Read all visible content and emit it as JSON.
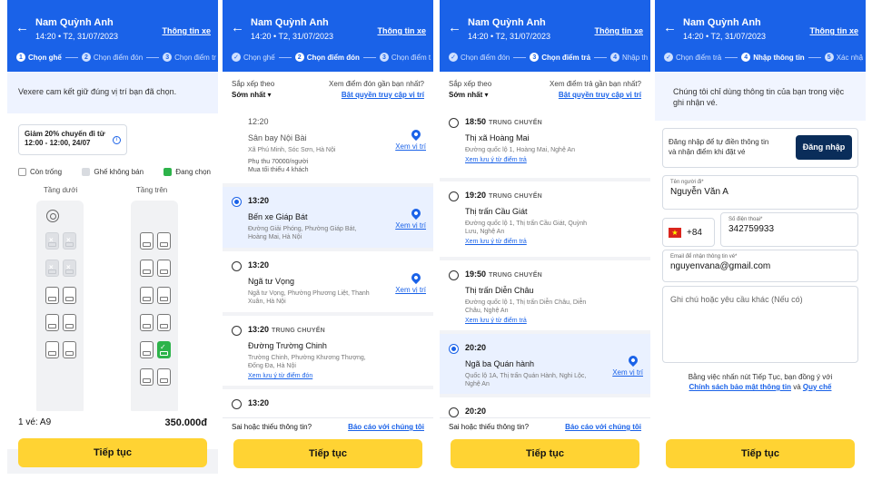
{
  "header": {
    "passenger": "Nam Quỳnh Anh",
    "trip_time": "14:20 • T2, 31/07/2023",
    "bus_info": "Thông tin xe"
  },
  "panel1": {
    "steps": [
      {
        "n": "1",
        "label": "Chọn ghế"
      },
      {
        "n": "2",
        "label": "Chọn điểm đón"
      },
      {
        "n": "3",
        "label": "Chọn điểm tr"
      }
    ],
    "commit_text": "Vexere cam kết giữ đúng vị trí bạn đã chọn.",
    "coupon_line1": "Giảm 20% chuyến đi từ",
    "coupon_line2": "12:00 - 12:00, 24/07",
    "legend": {
      "empty": "Còn trống",
      "sold": "Ghế không bán",
      "selected": "Đang chọn"
    },
    "deck_lower": "Tầng dưới",
    "deck_upper": "Tầng trên",
    "seat_icon": "seat-icon",
    "summary_label": "1 vé: A9",
    "total": "350.000đ",
    "cta": "Tiếp tục"
  },
  "panel2": {
    "steps": [
      {
        "n": "✓",
        "label": "Chọn ghế"
      },
      {
        "n": "2",
        "label": "Chọn điểm đón"
      },
      {
        "n": "3",
        "label": "Chọn điểm t"
      }
    ],
    "sort_label": "Sắp xếp theo",
    "sort_value": "Sớm nhất ▾",
    "nearest_label": "Xem điểm đón gần bạn nhất?",
    "nearest_link": "Bật quyền truy cập vị trí",
    "items": [
      {
        "time": "12:20",
        "tag": "",
        "name": "Sân bay Nội Bài",
        "addr": "Xã Phú Minh, Sóc Sơn, Hà Nội",
        "extra1": "Phụ thu 70000/người",
        "extra2": "Mua tối thiểu 4 khách",
        "link": "",
        "map": "Xem vị trí"
      },
      {
        "time": "13:20",
        "tag": "",
        "name": "Bến xe Giáp Bát",
        "addr": "Đường Giải Phóng, Phường Giáp Bát, Hoàng Mai, Hà Nội",
        "extra1": "",
        "extra2": "",
        "link": "",
        "map": "Xem vị trí"
      },
      {
        "time": "13:20",
        "tag": "",
        "name": "Ngã tư Vọng",
        "addr": "Ngã tư Vọng, Phường Phương Liệt, Thanh Xuân, Hà Nội",
        "extra1": "",
        "extra2": "",
        "link": "",
        "map": "Xem vị trí"
      },
      {
        "time": "13:20",
        "tag": "TRUNG CHUYỂN",
        "name": "Đường Trường Chinh",
        "addr": "Trường Chinh, Phường Khương Thượng, Đống Đa, Hà Nội",
        "extra1": "",
        "extra2": "",
        "link": "Xem lưu ý từ điểm đón",
        "map": ""
      },
      {
        "time": "13:20",
        "tag": "",
        "name": "",
        "addr": "",
        "extra1": "",
        "extra2": "",
        "link": "",
        "map": ""
      }
    ],
    "foot_q": "Sai hoặc thiếu thông tin?",
    "foot_link": "Báo cáo với chúng tôi",
    "cta": "Tiếp tục"
  },
  "panel3": {
    "steps": [
      {
        "n": "✓",
        "label": "Chọn điểm đón"
      },
      {
        "n": "3",
        "label": "Chọn điểm trả"
      },
      {
        "n": "4",
        "label": "Nhập th"
      }
    ],
    "sort_label": "Sắp xếp theo",
    "sort_value": "Sớm nhất ▾",
    "nearest_label": "Xem điểm trả gần bạn nhất?",
    "nearest_link": "Bật quyền truy cập vị trí",
    "items": [
      {
        "time": "18:50",
        "tag": "TRUNG CHUYỂN",
        "name": "Thị xã Hoàng Mai",
        "addr": "Đường quốc lộ 1, Hoàng Mai, Nghệ An",
        "link": "Xem lưu ý từ điểm trả",
        "map": ""
      },
      {
        "time": "19:20",
        "tag": "TRUNG CHUYỂN",
        "name": "Thị trấn Cầu Giát",
        "addr": "Đường quốc lộ 1, Thị trấn Cầu Giát, Quỳnh Lưu, Nghệ An",
        "link": "Xem lưu ý từ điểm trả",
        "map": ""
      },
      {
        "time": "19:50",
        "tag": "TRUNG CHUYỂN",
        "name": "Thị trấn Diễn Châu",
        "addr": "Đường quốc lộ 1, Thị trấn Diễn Châu, Diễn Châu, Nghệ An",
        "link": "Xem lưu ý từ điểm trả",
        "map": ""
      },
      {
        "time": "20:20",
        "tag": "",
        "name": "Ngã ba Quán hành",
        "addr": "Quốc lộ 1A, Thị trấn Quán Hành, Nghi Lộc, Nghệ An",
        "link": "",
        "map": "Xem vị trí"
      },
      {
        "time": "20:20",
        "tag": "",
        "name": "",
        "addr": "",
        "link": "",
        "map": ""
      }
    ],
    "foot_q": "Sai hoặc thiếu thông tin?",
    "foot_link": "Báo cáo với chúng tôi",
    "cta": "Tiếp tục"
  },
  "panel4": {
    "steps": [
      {
        "n": "✓",
        "label": "Chọn điểm trả"
      },
      {
        "n": "4",
        "label": "Nhập thông tin"
      },
      {
        "n": "5",
        "label": "Xác nhậ"
      }
    ],
    "note": "Chúng tôi chỉ dùng thông tin của bạn trong việc ghi nhận vé.",
    "login_text": "Đăng nhập để tự điền thông tin và nhận điểm khi đặt vé",
    "login_btn": "Đăng nhập",
    "name_label": "Tên người đi*",
    "name_value": "Nguyễn Văn A",
    "country_code": "+84",
    "phone_label": "Số điện thoại*",
    "phone_value": "342759933",
    "email_label": "Email để nhận thông tin vé*",
    "email_value": "nguyenvana@gmail.com",
    "notes_placeholder": "Ghi chú hoặc yêu cầu khác (Nếu có)",
    "terms_pre": "Bằng việc nhấn nút Tiếp Tục, bạn đồng ý với",
    "terms_link1": "Chính sách bảo mật thông tin",
    "terms_and": "và",
    "terms_link2": "Quy chế",
    "cta": "Tiếp tục"
  }
}
